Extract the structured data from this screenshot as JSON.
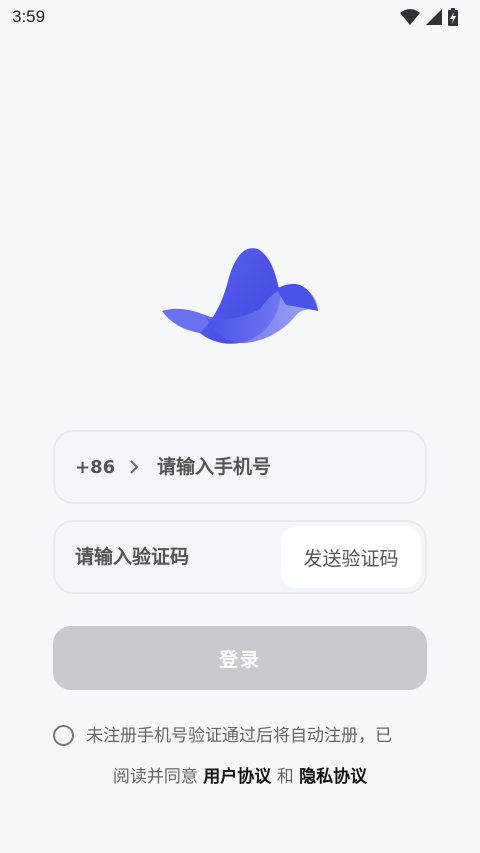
{
  "status_bar": {
    "time": "3:59",
    "icons": [
      "wifi-icon",
      "cellular-signal-icon",
      "battery-charging-icon"
    ]
  },
  "logo": {
    "icon": "bird-logo-icon",
    "colors": [
      "#4b52e8",
      "#7b83f4",
      "#a8adf9"
    ]
  },
  "phone": {
    "country_code": "+86",
    "placeholder": "请输入手机号",
    "value": ""
  },
  "code": {
    "placeholder": "请输入验证码",
    "value": "",
    "send_label": "发送验证码"
  },
  "login": {
    "label": "登录",
    "enabled": false,
    "color": "#c9cace"
  },
  "agreement": {
    "checked": false,
    "line1": "未注册手机号验证通过后将自动注册，已",
    "line2_prefix": "阅读并同意",
    "user_agreement": "用户协议",
    "conjunction": "和",
    "privacy_policy": "隐私协议"
  }
}
